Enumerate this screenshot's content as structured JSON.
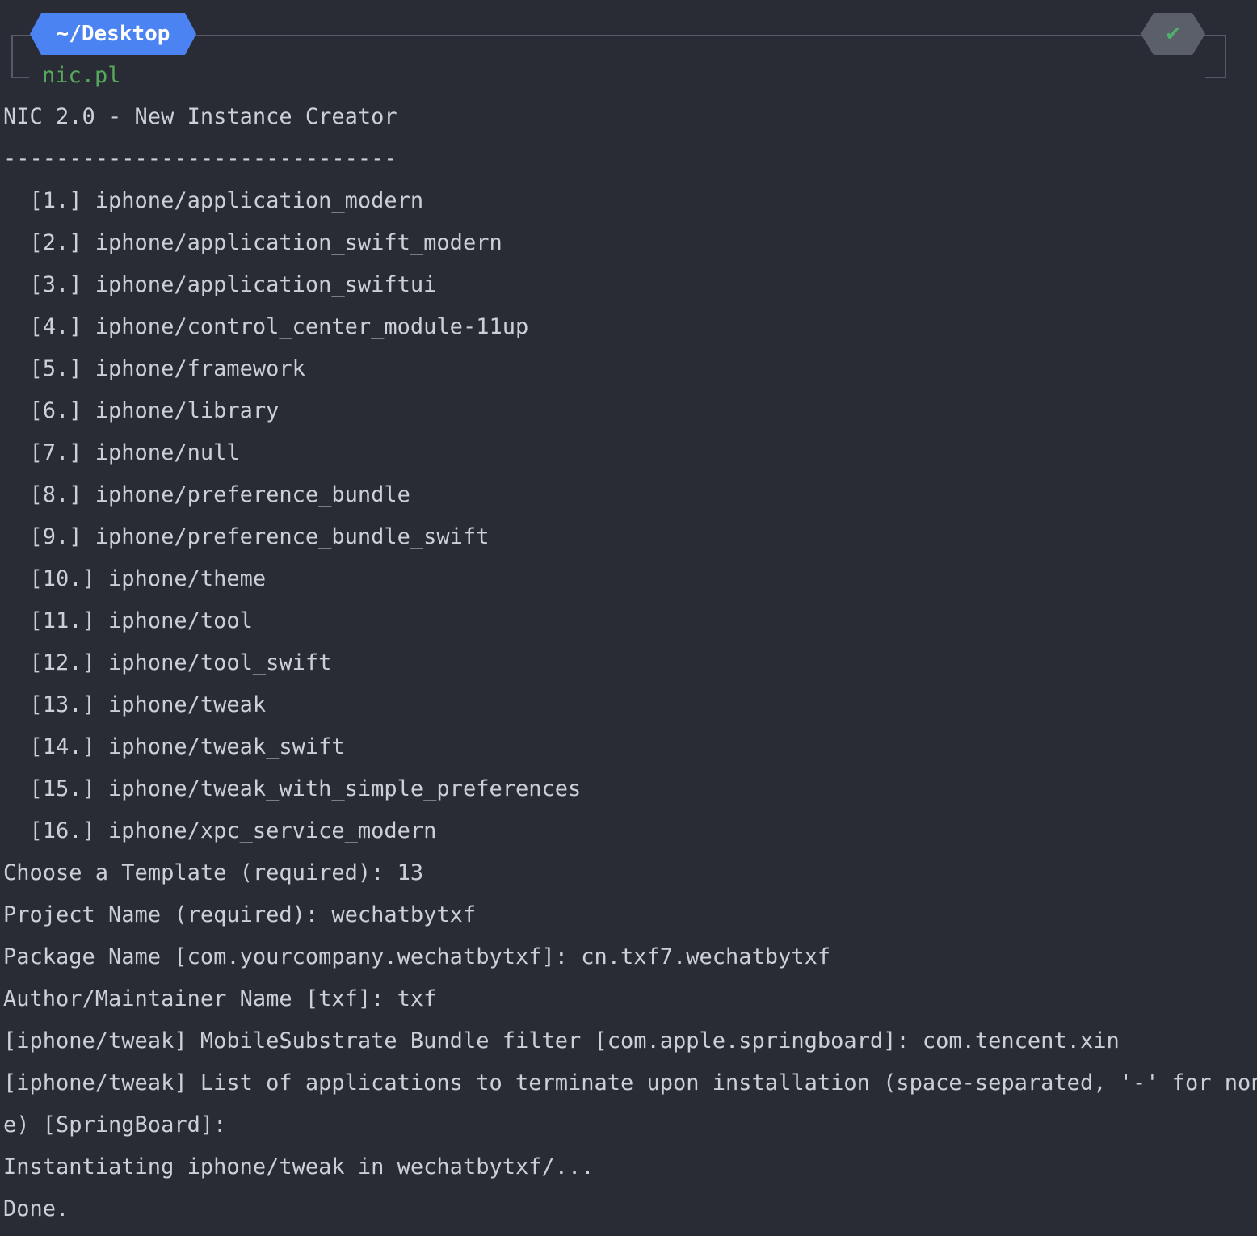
{
  "prompt": {
    "directory": "~/Desktop",
    "status_icon": "check-icon",
    "status_symbol": "✔",
    "command": "nic.pl"
  },
  "output": {
    "lines": [
      "NIC 2.0 - New Instance Creator",
      "------------------------------",
      "  [1.] iphone/application_modern",
      "  [2.] iphone/application_swift_modern",
      "  [3.] iphone/application_swiftui",
      "  [4.] iphone/control_center_module-11up",
      "  [5.] iphone/framework",
      "  [6.] iphone/library",
      "  [7.] iphone/null",
      "  [8.] iphone/preference_bundle",
      "  [9.] iphone/preference_bundle_swift",
      "  [10.] iphone/theme",
      "  [11.] iphone/tool",
      "  [12.] iphone/tool_swift",
      "  [13.] iphone/tweak",
      "  [14.] iphone/tweak_swift",
      "  [15.] iphone/tweak_with_simple_preferences",
      "  [16.] iphone/xpc_service_modern",
      "Choose a Template (required): 13",
      "Project Name (required): wechatbytxf",
      "Package Name [com.yourcompany.wechatbytxf]: cn.txf7.wechatbytxf",
      "Author/Maintainer Name [txf]: txf",
      "[iphone/tweak] MobileSubstrate Bundle filter [com.apple.springboard]: com.tencent.xin",
      "[iphone/tweak] List of applications to terminate upon installation (space-separated, '-' for non",
      "e) [SpringBoard]:",
      "Instantiating iphone/tweak in wechatbytxf/...",
      "Done."
    ]
  },
  "colors": {
    "background": "#292c35",
    "text": "#cbcfd6",
    "command": "#56a85d",
    "dir_badge": "#4c83f2",
    "status_badge": "#5a5f69",
    "status_ok": "#4fb26a",
    "frame": "#555a64"
  }
}
